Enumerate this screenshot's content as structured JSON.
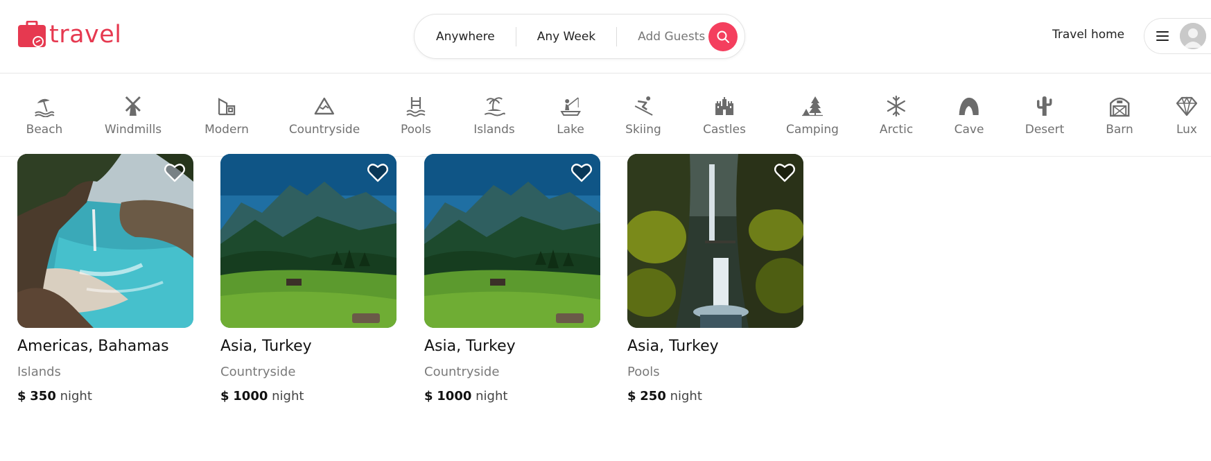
{
  "header": {
    "logo_text": "travel",
    "search": {
      "location": "Anywhere",
      "week": "Any Week",
      "guests": "Add Guests"
    },
    "host_link": "Travel home"
  },
  "categories": [
    {
      "label": "Beach",
      "icon": "beach-umbrella-icon"
    },
    {
      "label": "Windmills",
      "icon": "windmill-icon"
    },
    {
      "label": "Modern",
      "icon": "modern-building-icon"
    },
    {
      "label": "Countryside",
      "icon": "mountain-icon"
    },
    {
      "label": "Pools",
      "icon": "pool-icon"
    },
    {
      "label": "Islands",
      "icon": "island-icon"
    },
    {
      "label": "Lake",
      "icon": "lake-fishing-icon"
    },
    {
      "label": "Skiing",
      "icon": "skiing-icon"
    },
    {
      "label": "Castles",
      "icon": "castle-icon"
    },
    {
      "label": "Camping",
      "icon": "camping-icon"
    },
    {
      "label": "Arctic",
      "icon": "snowflake-icon"
    },
    {
      "label": "Cave",
      "icon": "cave-icon"
    },
    {
      "label": "Desert",
      "icon": "cactus-icon"
    },
    {
      "label": "Barn",
      "icon": "barn-icon"
    },
    {
      "label": "Lux",
      "icon": "diamond-icon"
    }
  ],
  "listings": [
    {
      "location": "Americas, Bahamas",
      "category": "Islands",
      "currency": "$",
      "price": "350",
      "unit": "night",
      "image": "coastal-cove-waterfall-photo"
    },
    {
      "location": "Asia, Turkey",
      "category": "Countryside",
      "currency": "$",
      "price": "1000",
      "unit": "night",
      "image": "alpine-meadow-photo"
    },
    {
      "location": "Asia, Turkey",
      "category": "Countryside",
      "currency": "$",
      "price": "1000",
      "unit": "night",
      "image": "alpine-meadow-photo"
    },
    {
      "location": "Asia, Turkey",
      "category": "Pools",
      "currency": "$",
      "price": "250",
      "unit": "night",
      "image": "forest-waterfall-photo"
    }
  ],
  "colors": {
    "brand": "#e63950",
    "search_button": "#f43f5e",
    "muted_text": "#707070"
  }
}
